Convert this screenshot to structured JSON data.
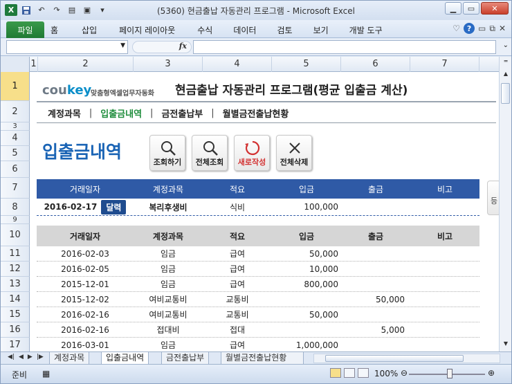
{
  "window": {
    "title": "(5360) 현금출납 자동관리 프로그램 - Microsoft Excel",
    "app_icon": "X"
  },
  "ribbon": {
    "file_tab": "파일",
    "tabs": [
      "홈",
      "삽입",
      "페이지 레이아웃",
      "수식",
      "데이터",
      "검토",
      "보기",
      "개발 도구"
    ],
    "help": "?"
  },
  "formula_bar": {
    "fx": "fx"
  },
  "columns": [
    "1",
    "2",
    "3",
    "4",
    "5",
    "6",
    "7"
  ],
  "rows": [
    "1",
    "2",
    "3",
    "4",
    "5",
    "6",
    "7",
    "8",
    "9",
    "10",
    "11",
    "12",
    "13",
    "14",
    "15",
    "16",
    "17"
  ],
  "brand": {
    "name_part1": "cou",
    "name_part2": "key",
    "tagline": "맞춤형엑셀업무자동화"
  },
  "app_title": "현금출납 자동관리 프로그램(평균 입출금 계산)",
  "nav": {
    "items": [
      "계정과목",
      "입출금내역",
      "금전출납부",
      "월별금전출납현황"
    ],
    "active_index": 1
  },
  "page_heading": "입출금내역",
  "buttons": {
    "search": "조회하기",
    "search_all": "전체조회",
    "new": "새로작성",
    "delete_all": "전체삭제"
  },
  "side_button": "등",
  "input_table": {
    "headers": [
      "거래일자",
      "계정과목",
      "적요",
      "입금",
      "출금",
      "비고"
    ],
    "row": {
      "date": "2016-02-17",
      "calendar_label": "달력",
      "account": "복리후생비",
      "memo": "식비",
      "deposit": "100,000",
      "withdrawal": "",
      "note": ""
    }
  },
  "list_table": {
    "headers": [
      "거래일자",
      "계정과목",
      "적요",
      "입금",
      "출금",
      "비고"
    ],
    "rows": [
      [
        "2016-02-03",
        "임금",
        "급여",
        "50,000",
        "",
        ""
      ],
      [
        "2016-02-05",
        "임금",
        "급여",
        "10,000",
        "",
        ""
      ],
      [
        "2015-12-01",
        "임금",
        "급여",
        "800,000",
        "",
        ""
      ],
      [
        "2015-12-02",
        "여비교통비",
        "교통비",
        "",
        "50,000",
        ""
      ],
      [
        "2016-02-16",
        "여비교통비",
        "교통비",
        "50,000",
        "",
        ""
      ],
      [
        "2016-02-16",
        "접대비",
        "접대",
        "",
        "5,000",
        ""
      ],
      [
        "2016-03-01",
        "임금",
        "급여",
        "1,000,000",
        "",
        ""
      ]
    ]
  },
  "sheet_tabs": [
    "계정과목",
    "입출금내역",
    "금전출납부",
    "월별금전출납현황"
  ],
  "active_sheet_index": 1,
  "status": {
    "ready": "준비",
    "zoom": "100%"
  },
  "colors": {
    "accent_blue": "#2f5aa6",
    "heading_blue": "#1a64b5",
    "active_green": "#1d8c3b",
    "new_button_red": "#d23030"
  }
}
